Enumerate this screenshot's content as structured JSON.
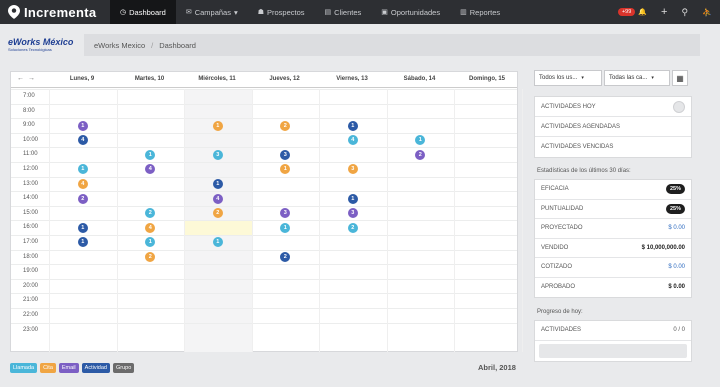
{
  "topbar": {
    "brand": "Incrementa",
    "nav": [
      {
        "label": "Dashboard",
        "icon": "dashboard-icon",
        "glyph": "◷",
        "active": true
      },
      {
        "label": "Campañas",
        "icon": "megaphone-icon",
        "glyph": "✉",
        "active": false,
        "caret": "▾"
      },
      {
        "label": "Prospectos",
        "icon": "user-icon",
        "glyph": "☗",
        "active": false
      },
      {
        "label": "Clientes",
        "icon": "book-icon",
        "glyph": "▤",
        "active": false
      },
      {
        "label": "Oportunidades",
        "icon": "briefcase-icon",
        "glyph": "▣",
        "active": false
      },
      {
        "label": "Reportes",
        "icon": "report-icon",
        "glyph": "▥",
        "active": false
      }
    ],
    "notifications": "+99",
    "bell_glyph": "🔔",
    "plus_glyph": "+",
    "search_glyph": "⚲",
    "user_glyph": "⛹"
  },
  "header": {
    "logo_line1": "eWorks México",
    "logo_line2": "Soluciones Tecnológicas",
    "breadcrumb_company": "eWorks Mexico",
    "breadcrumb_sep": "/",
    "breadcrumb_page": "Dashboard"
  },
  "calendar": {
    "prev": "←",
    "next": "→",
    "days": [
      "Lunes, 9",
      "Martes, 10",
      "Miércoles, 11",
      "Jueves, 12",
      "Viernes, 13",
      "Sábado, 14",
      "Domingo, 15"
    ],
    "hours": [
      "7:00",
      "8:00",
      "9:00",
      "10:00",
      "11:00",
      "12:00",
      "13:00",
      "14:00",
      "15:00",
      "16:00",
      "17:00",
      "18:00",
      "19:00",
      "20:00",
      "21:00",
      "22:00",
      "23:00"
    ],
    "events": [
      {
        "day": 0,
        "hour": 2,
        "n": "1",
        "type": "email"
      },
      {
        "day": 0,
        "hour": 3,
        "n": "4",
        "type": "actividad"
      },
      {
        "day": 0,
        "hour": 5,
        "n": "1",
        "type": "llamada"
      },
      {
        "day": 0,
        "hour": 6,
        "n": "4",
        "type": "cita"
      },
      {
        "day": 0,
        "hour": 7,
        "n": "2",
        "type": "email"
      },
      {
        "day": 0,
        "hour": 9,
        "n": "1",
        "type": "actividad"
      },
      {
        "day": 0,
        "hour": 10,
        "n": "1",
        "type": "actividad"
      },
      {
        "day": 1,
        "hour": 4,
        "n": "1",
        "type": "llamada"
      },
      {
        "day": 1,
        "hour": 5,
        "n": "4",
        "type": "email"
      },
      {
        "day": 1,
        "hour": 8,
        "n": "2",
        "type": "llamada"
      },
      {
        "day": 1,
        "hour": 9,
        "n": "4",
        "type": "cita"
      },
      {
        "day": 1,
        "hour": 10,
        "n": "1",
        "type": "llamada"
      },
      {
        "day": 1,
        "hour": 11,
        "n": "2",
        "type": "cita"
      },
      {
        "day": 2,
        "hour": 2,
        "n": "1",
        "type": "cita"
      },
      {
        "day": 2,
        "hour": 4,
        "n": "3",
        "type": "llamada"
      },
      {
        "day": 2,
        "hour": 6,
        "n": "1",
        "type": "actividad"
      },
      {
        "day": 2,
        "hour": 7,
        "n": "4",
        "type": "email"
      },
      {
        "day": 2,
        "hour": 8,
        "n": "2",
        "type": "cita"
      },
      {
        "day": 2,
        "hour": 10,
        "n": "1",
        "type": "llamada"
      },
      {
        "day": 3,
        "hour": 2,
        "n": "2",
        "type": "cita"
      },
      {
        "day": 3,
        "hour": 4,
        "n": "3",
        "type": "actividad"
      },
      {
        "day": 3,
        "hour": 5,
        "n": "1",
        "type": "cita"
      },
      {
        "day": 3,
        "hour": 8,
        "n": "3",
        "type": "email"
      },
      {
        "day": 3,
        "hour": 9,
        "n": "1",
        "type": "llamada"
      },
      {
        "day": 3,
        "hour": 11,
        "n": "2",
        "type": "actividad"
      },
      {
        "day": 4,
        "hour": 2,
        "n": "1",
        "type": "actividad"
      },
      {
        "day": 4,
        "hour": 3,
        "n": "4",
        "type": "llamada"
      },
      {
        "day": 4,
        "hour": 5,
        "n": "3",
        "type": "cita"
      },
      {
        "day": 4,
        "hour": 7,
        "n": "1",
        "type": "actividad"
      },
      {
        "day": 4,
        "hour": 8,
        "n": "3",
        "type": "email"
      },
      {
        "day": 4,
        "hour": 9,
        "n": "2",
        "type": "llamada"
      },
      {
        "day": 5,
        "hour": 3,
        "n": "1",
        "type": "llamada"
      },
      {
        "day": 5,
        "hour": 4,
        "n": "2",
        "type": "email"
      }
    ],
    "month_label": "Abril, 2018"
  },
  "legend": [
    {
      "label": "Llamada",
      "type": "llamada"
    },
    {
      "label": "Cita",
      "type": "cita"
    },
    {
      "label": "Email",
      "type": "email"
    },
    {
      "label": "Actividad",
      "type": "actividad"
    },
    {
      "label": "Grupo",
      "type": "grupo"
    }
  ],
  "colors": {
    "llamada": "#4ab6d9",
    "cita": "#f0a543",
    "email": "#7c5fc4",
    "actividad": "#2c5aa6",
    "grupo": "#6b6b6b",
    "nav_bg": "#2d2f33"
  },
  "filters": {
    "users": "Todos los us...",
    "campaigns": "Todas las ca...",
    "caret": "▾",
    "calendar_glyph": "▦"
  },
  "activities": [
    {
      "label": "ACTIVIDADES HOY"
    },
    {
      "label": "ACTIVIDADES AGENDADAS"
    },
    {
      "label": "ACTIVIDADES VENCIDAS"
    }
  ],
  "stats": {
    "title": "Estadísticas de los últimos 30 días:",
    "rows": [
      {
        "label": "EFICACIA",
        "value": "25%",
        "style": "pill"
      },
      {
        "label": "PUNTUALIDAD",
        "value": "25%",
        "style": "pill"
      },
      {
        "label": "PROYECTADO",
        "value": "$ 0.00",
        "style": "blue"
      },
      {
        "label": "VENDIDO",
        "value": "$ 10,000,000.00",
        "style": "dark"
      },
      {
        "label": "COTIZADO",
        "value": "$ 0.00",
        "style": "blue"
      },
      {
        "label": "APROBADO",
        "value": "$ 0.00",
        "style": "dark"
      }
    ]
  },
  "progress": {
    "title": "Progreso de hoy:",
    "label": "ACTIVIDADES",
    "value": "0 / 0",
    "fraction": 0
  }
}
